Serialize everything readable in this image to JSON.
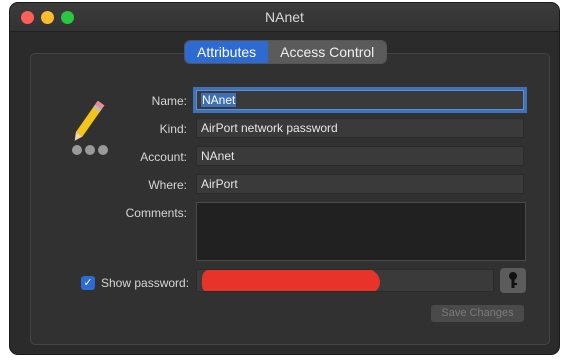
{
  "window": {
    "title": "NAnet"
  },
  "tabs": [
    {
      "label": "Attributes",
      "active": true
    },
    {
      "label": "Access Control",
      "active": false
    }
  ],
  "form": {
    "name_label": "Name:",
    "name_value": "NAnet",
    "kind_label": "Kind:",
    "kind_value": "AirPort network password",
    "account_label": "Account:",
    "account_value": "NAnet",
    "where_label": "Where:",
    "where_value": "AirPort",
    "comments_label": "Comments:",
    "comments_value": "",
    "show_password_label": "Show password:",
    "show_password_checked": true
  },
  "buttons": {
    "save_label": "Save Changes",
    "key_icon": "key-icon"
  },
  "colors": {
    "accent": "#2d6ad1",
    "redaction": "#e8332a",
    "window_bg": "#2b2b2b"
  }
}
